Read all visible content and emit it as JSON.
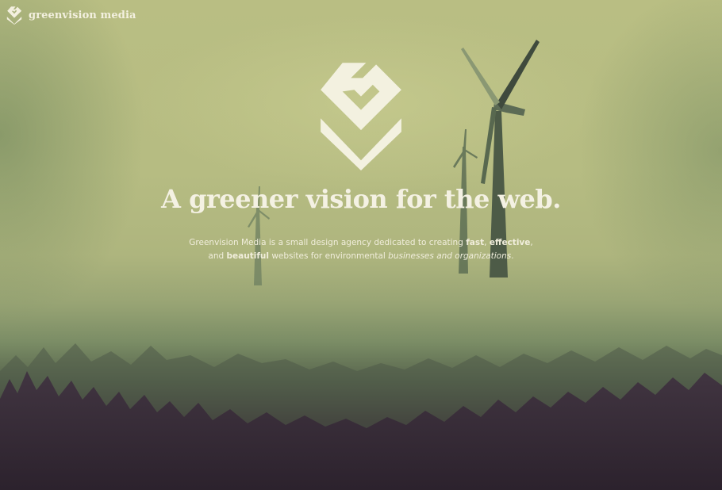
{
  "brand": {
    "name": "greenvision media",
    "icon": "greenvision-logo-icon"
  },
  "hero": {
    "logo_icon": "greenvision-large-logo",
    "headline": "A greener vision for the web.",
    "tagline": {
      "l1_before": "Greenvision Media is a small design agency dedicated to creating ",
      "l1_fast": "fast",
      "l1_comma": ", ",
      "l1_effective": "effective",
      "l1_end": ",",
      "l2_before": "and ",
      "l2_beautiful": "beautiful",
      "l2_middle": " websites for environmental ",
      "l2_italic": "businesses and organizations",
      "l2_end": "."
    }
  },
  "colors": {
    "sky": "#b7bd82",
    "text": "#f4f1e3",
    "forest": "#2f2430"
  }
}
